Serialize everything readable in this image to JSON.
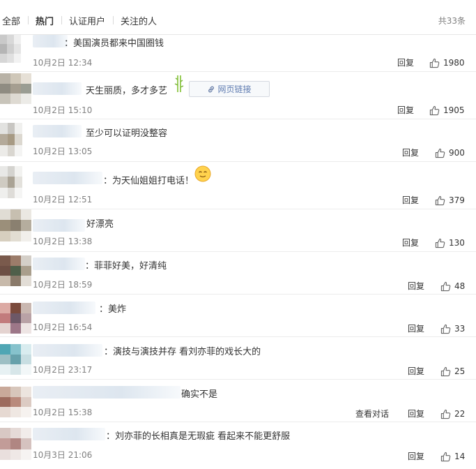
{
  "tabs": {
    "all": "全部",
    "hot": "热门",
    "verified": "认证用户",
    "following": "关注的人"
  },
  "total": "共33条",
  "link_button": "网页链接",
  "comments": [
    {
      "text": "：美国演员都来中国圈钱",
      "time": "10月2日 12:34",
      "reply": "回复",
      "likes": "1980"
    },
    {
      "text": "天生丽质，多才多艺",
      "time": "10月2日 15:10",
      "reply": "回复",
      "likes": "1905"
    },
    {
      "text": "至少可以证明没整容",
      "time": "10月2日 13:05",
      "reply": "回复",
      "likes": "900"
    },
    {
      "text": "：为天仙姐姐打电话！",
      "time": "10月2日 12:51",
      "reply": "回复",
      "likes": "379"
    },
    {
      "text": "好漂亮",
      "time": "10月2日 13:38",
      "reply": "回复",
      "likes": "130"
    },
    {
      "text": "：菲菲好美，好清纯",
      "time": "10月2日 18:59",
      "reply": "回复",
      "likes": "48"
    },
    {
      "text": "：美炸",
      "time": "10月2日 16:54",
      "reply": "回复",
      "likes": "33"
    },
    {
      "text": "：演技与演技并存 看刘亦菲的戏长大的",
      "time": "10月2日 23:17",
      "reply": "回复",
      "likes": "25"
    },
    {
      "text": "确实不是",
      "time": "10月2日 15:38",
      "reply": "回复",
      "convo": "查看对话",
      "likes": "22"
    },
    {
      "text": "：刘亦菲的长相真是无瑕疵 看起来不能更舒服",
      "time": "10月3日 21:06",
      "reply": "回复",
      "likes": "14"
    }
  ]
}
